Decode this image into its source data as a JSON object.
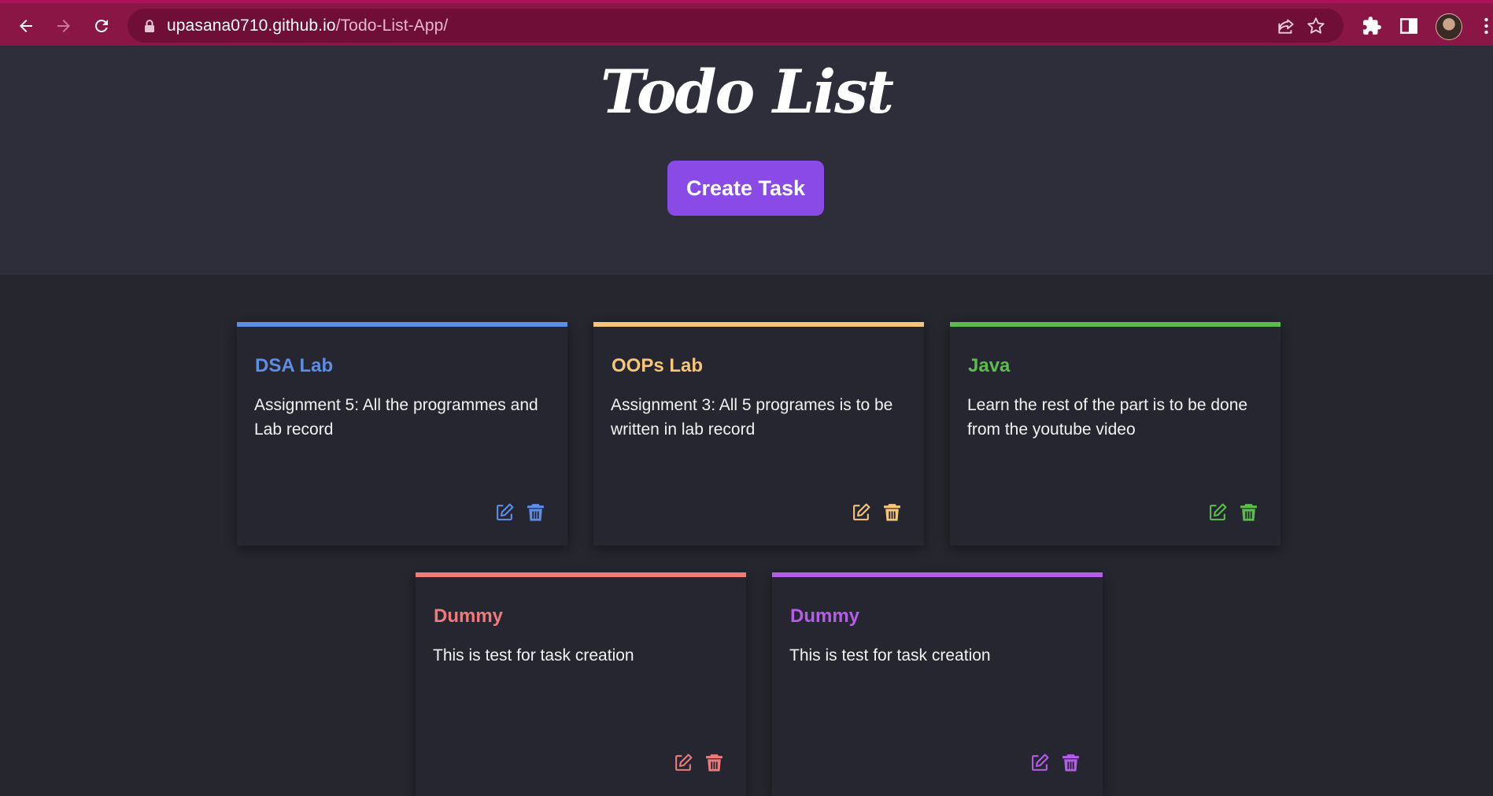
{
  "browser": {
    "url_host": "upasana0710.github.io",
    "url_path": "/Todo-List-App/"
  },
  "header": {
    "title": "Todo List",
    "create_button_label": "Create Task"
  },
  "colors": {
    "accent": "#8a4ae6",
    "chrome": "#8a1646"
  },
  "tasks": [
    {
      "title": "DSA Lab",
      "description": "Assignment 5: All the programmes and Lab record",
      "color": "#5e8de6"
    },
    {
      "title": "OOPs Lab",
      "description": "Assignment 3: All 5 programes is to be written in lab record",
      "color": "#f5c57a"
    },
    {
      "title": "Java",
      "description": "Learn the rest of the part is to be done from the youtube video",
      "color": "#5cbd4e"
    },
    {
      "title": "Dummy",
      "description": "This is test for task creation",
      "color": "#ee7a7a"
    },
    {
      "title": "Dummy",
      "description": "This is test for task creation",
      "color": "#b45ee8"
    }
  ],
  "icons": {
    "edit": "edit-icon",
    "delete": "trash-icon"
  }
}
